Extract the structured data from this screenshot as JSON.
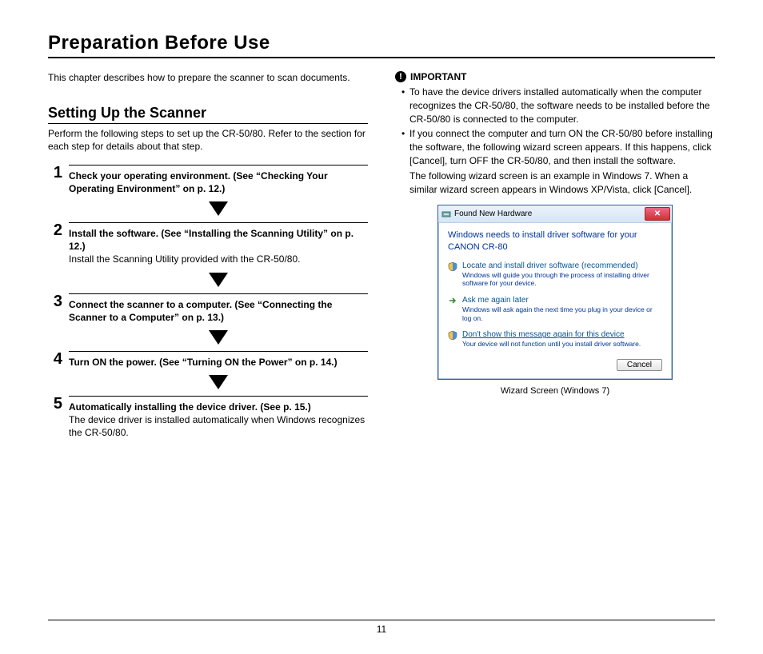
{
  "page": {
    "title": "Preparation Before Use",
    "number": "11"
  },
  "left": {
    "intro": "This chapter describes how to prepare the scanner to scan documents.",
    "section_heading": "Setting Up the Scanner",
    "section_sub": "Perform the following steps to set up the CR-50/80. Refer to the section for each step for details about that step.",
    "steps": {
      "s1": {
        "num": "1",
        "title": "Check your operating environment. (See “Checking Your Operating Environment” on p. 12.)"
      },
      "s2": {
        "num": "2",
        "title": "Install the software. (See “Installing the Scanning Utility” on p. 12.)",
        "body": "Install the Scanning Utility provided with the CR-50/80."
      },
      "s3": {
        "num": "3",
        "title": "Connect the scanner to a computer. (See “Connecting the Scanner to a Computer” on p. 13.)"
      },
      "s4": {
        "num": "4",
        "title": "Turn ON the power. (See “Turning ON the Power” on p. 14.)"
      },
      "s5": {
        "num": "5",
        "title": "Automatically installing the device driver. (See p. 15.)",
        "body": "The device driver is installed automatically when Windows recognizes the CR-50/80."
      }
    }
  },
  "right": {
    "important_label": "IMPORTANT",
    "bullets": {
      "b1": "To have the device drivers installed automatically when the computer recognizes the CR-50/80, the software needs to be installed before the CR-50/80 is connected to the computer.",
      "b2": "If you connect the computer and turn ON the CR-50/80 before installing the software, the following wizard screen appears. If this happens, click [Cancel], turn OFF the CR-50/80, and then install the software.",
      "b2_inset": "The following wizard screen is an example in Windows 7. When a similar wizard screen appears in Windows XP/Vista, click [Cancel]."
    },
    "dialog": {
      "window_title": "Found New Hardware",
      "message": "Windows needs to install driver software for your CANON CR-80",
      "opt1_title": "Locate and install driver software (recommended)",
      "opt1_sub": "Windows will guide you through the process of installing driver software for your device.",
      "opt2_title": "Ask me again later",
      "opt2_sub": "Windows will ask again the next time you plug in your device or log on.",
      "opt3_title": "Don't show this message again for this device",
      "opt3_sub": "Your device will not function until you install driver software.",
      "cancel": "Cancel",
      "caption": "Wizard Screen (Windows 7)"
    }
  }
}
